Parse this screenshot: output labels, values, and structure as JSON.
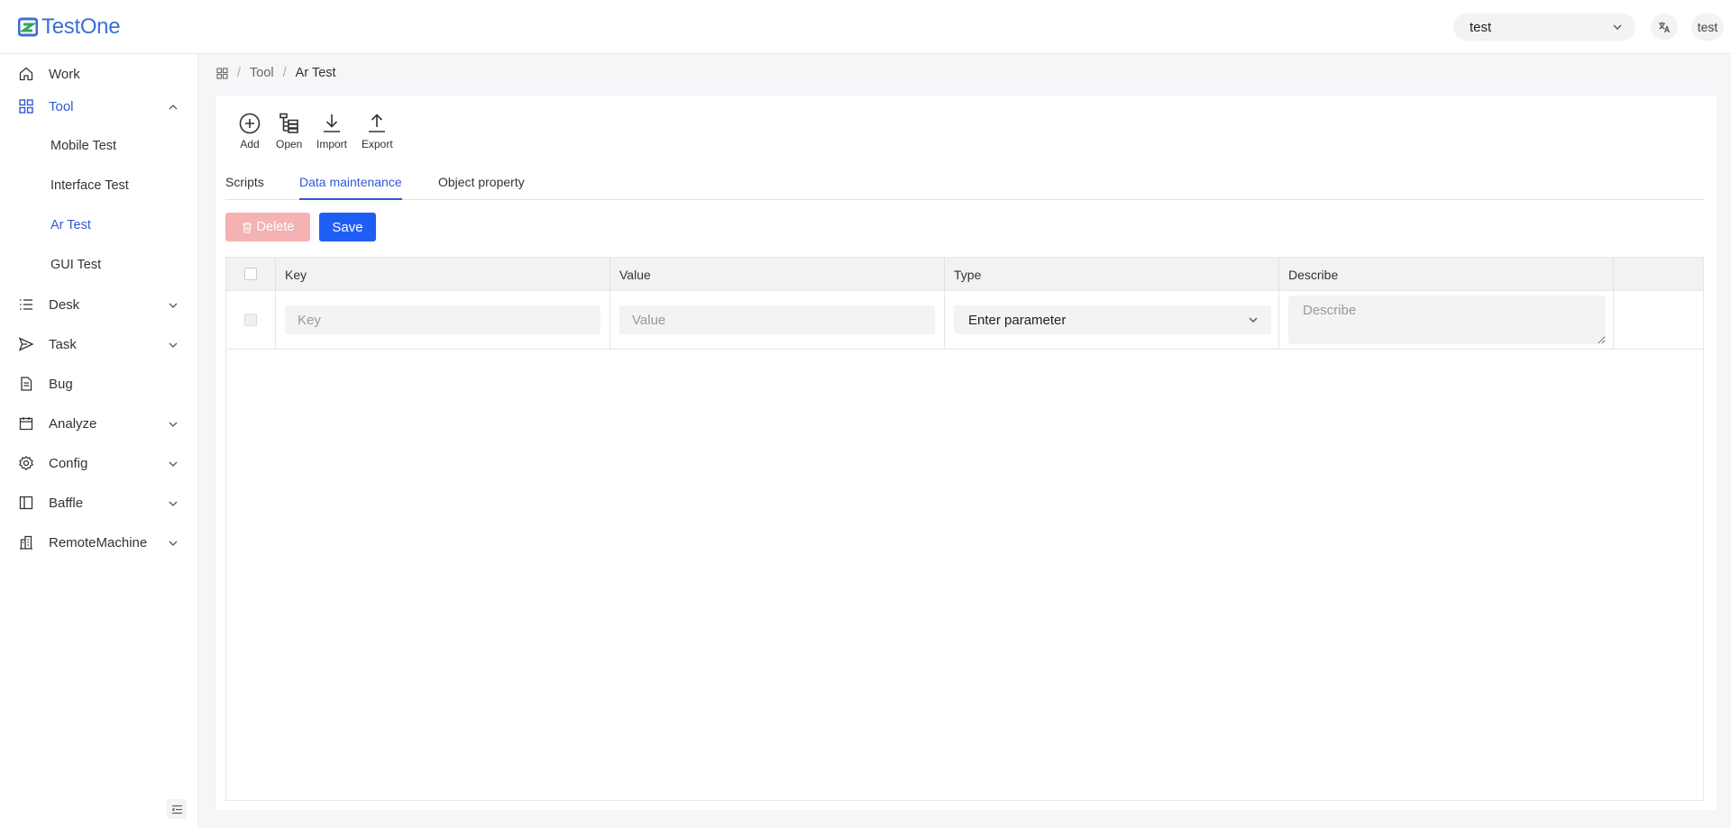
{
  "app": {
    "name": "TestOne"
  },
  "header": {
    "project": "test",
    "user": "test"
  },
  "sidebar": {
    "items": [
      {
        "label": "Work"
      },
      {
        "label": "Tool"
      },
      {
        "label": "Desk"
      },
      {
        "label": "Task"
      },
      {
        "label": "Bug"
      },
      {
        "label": "Analyze"
      },
      {
        "label": "Config"
      },
      {
        "label": "Baffle"
      },
      {
        "label": "RemoteMachine"
      }
    ],
    "tool_children": [
      {
        "label": "Mobile Test"
      },
      {
        "label": "Interface Test"
      },
      {
        "label": "Ar Test"
      },
      {
        "label": "GUI Test"
      }
    ]
  },
  "breadcrumb": {
    "items": [
      "Tool",
      "Ar Test"
    ]
  },
  "toolbar": {
    "add": "Add",
    "open": "Open",
    "import": "Import",
    "export": "Export"
  },
  "tabs": [
    "Scripts",
    "Data maintenance",
    "Object property"
  ],
  "actions": {
    "delete": "Delete",
    "save": "Save"
  },
  "table": {
    "columns": [
      "Key",
      "Value",
      "Type",
      "Describe"
    ],
    "row": {
      "key_placeholder": "Key",
      "value_placeholder": "Value",
      "type_value": "Enter parameter",
      "describe_placeholder": "Describe"
    }
  },
  "colors": {
    "accent": "#2f5bd3",
    "primary_button": "#1f5ef5",
    "delete_disabled": "#f4b2b2"
  },
  "icons": [
    "logo-icon",
    "chevron-down-icon",
    "translate-icon",
    "home-icon",
    "grid-icon",
    "list-icon",
    "send-icon",
    "document-icon",
    "calendar-icon",
    "gear-icon",
    "panel-icon",
    "building-icon",
    "add-circle-icon",
    "tree-icon",
    "download-icon",
    "upload-icon",
    "trash-icon",
    "collapse-icon"
  ]
}
